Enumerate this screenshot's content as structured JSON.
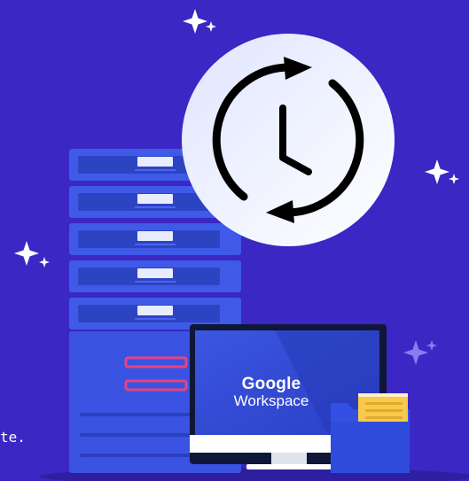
{
  "brand": {
    "line1": "Google",
    "line2": "Workspace"
  },
  "caption": {
    "text": "te."
  },
  "colors": {
    "background": "#3a27c4",
    "server_body": "#3f5ae8",
    "server_slot": "#2d44c2",
    "accent_pink": "#e5437f",
    "folder_yellow": "#f7c94d",
    "clock_face": "#f1f3ff"
  },
  "icons": [
    "sparkle-icon",
    "clock-sync-icon",
    "server-rack-icon",
    "monitor-icon",
    "folder-icon"
  ]
}
